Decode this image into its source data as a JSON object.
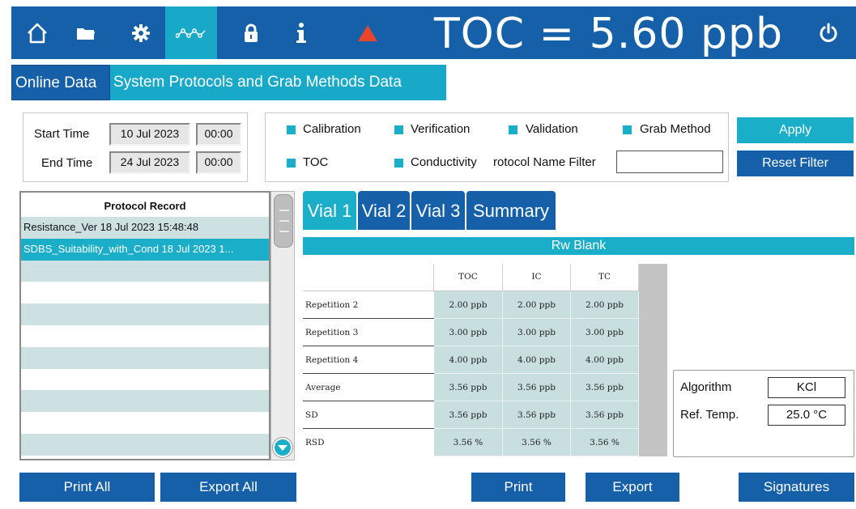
{
  "topbar": {
    "icons": [
      "home-icon",
      "folder-icon",
      "gear-icon",
      "trend-icon",
      "lock-icon",
      "info-icon",
      "alarm-triangle-icon"
    ],
    "active_icon": "trend-icon",
    "toc_reading": "TOC = 5.60 ppb",
    "power_icon": "power-icon"
  },
  "tabs": {
    "online": "Online Data",
    "system": "System Protocols and Grab Methods Data"
  },
  "filters": {
    "start_label": "Start Time",
    "start_date": "10 Jul 2023",
    "start_time": "00:00",
    "end_label": "End Time",
    "end_date": "24 Jul 2023",
    "end_time": "00:00",
    "checks": {
      "calibration": "Calibration",
      "verification": "Verification",
      "validation": "Validation",
      "grab_method": "Grab Method",
      "toc": "TOC",
      "conductivity": "Conductivity"
    },
    "protocol_filter_label": "rotocol Name Filter",
    "protocol_filter_value": "",
    "apply": "Apply",
    "reset": "Reset Filter"
  },
  "protocols": {
    "header": "Protocol Record",
    "items": [
      "Resistance_Ver 18 Jul 2023 15:48:48",
      "SDBS_Suitability_with_Cond 18 Jul 2023 1..."
    ]
  },
  "vial_tabs": [
    "Vial 1",
    "Vial 2",
    "Vial 3",
    "Summary"
  ],
  "section_title": "Rw Blank",
  "table": {
    "columns": [
      "TOC",
      "IC",
      "TC"
    ],
    "rows": [
      {
        "label": "Repetition 2",
        "values": [
          "2.00 ppb",
          "2.00 ppb",
          "2.00 ppb"
        ]
      },
      {
        "label": "Repetition 3",
        "values": [
          "3.00 ppb",
          "3.00 ppb",
          "3.00 ppb"
        ]
      },
      {
        "label": "Repetition 4",
        "values": [
          "4.00 ppb",
          "4.00 ppb",
          "4.00 ppb"
        ]
      },
      {
        "label": "Average",
        "values": [
          "3.56 ppb",
          "3.56 ppb",
          "3.56 ppb"
        ]
      },
      {
        "label": "SD",
        "values": [
          "3.56 ppb",
          "3.56 ppb",
          "3.56 ppb"
        ]
      },
      {
        "label": "RSD",
        "values": [
          "3.56 %",
          "3.56 %",
          "3.56 %"
        ]
      }
    ]
  },
  "algorithm": {
    "algorithm_label": "Algorithm",
    "algorithm_value": "KCl",
    "ref_temp_label": "Ref. Temp.",
    "ref_temp_value": "25.0 °C"
  },
  "buttons": {
    "print_all": "Print All",
    "export_all": "Export All",
    "print": "Print",
    "export": "Export",
    "signatures": "Signatures"
  },
  "colors": {
    "primary_blue": "#1560a8",
    "accent_cyan": "#1aaec9",
    "row_alt": "#cde1e3",
    "alarm_red": "#e8452c"
  }
}
